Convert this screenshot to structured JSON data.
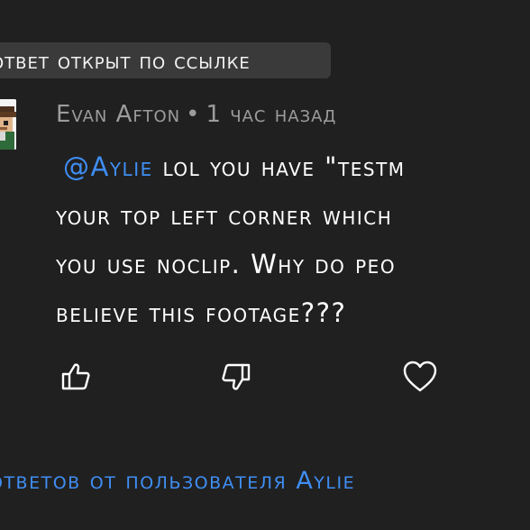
{
  "thread": {
    "link_chip_label": "ответ открыт по ссылке"
  },
  "comment": {
    "author": "Evan Afton",
    "separator": "•",
    "time_ago": "1 час назад",
    "mention": "@Aylie",
    "lines": [
      "lol you have \"testm",
      "your top left corner which",
      "you use noclip. Why do peo",
      "believe this footage???"
    ],
    "avatar_icon": "pixel-character-avatar"
  },
  "actions": {
    "like_icon": "thumbs-up-icon",
    "dislike_icon": "thumbs-down-icon",
    "heart_icon": "heart-icon"
  },
  "replies": {
    "label": "ответов от пользователя Aylie"
  },
  "colors": {
    "background": "#202020",
    "chip_background": "#3a3a3a",
    "accent_blue": "#3f8ef3",
    "meta_gray": "#9c9c9c",
    "text": "#ffffff"
  }
}
